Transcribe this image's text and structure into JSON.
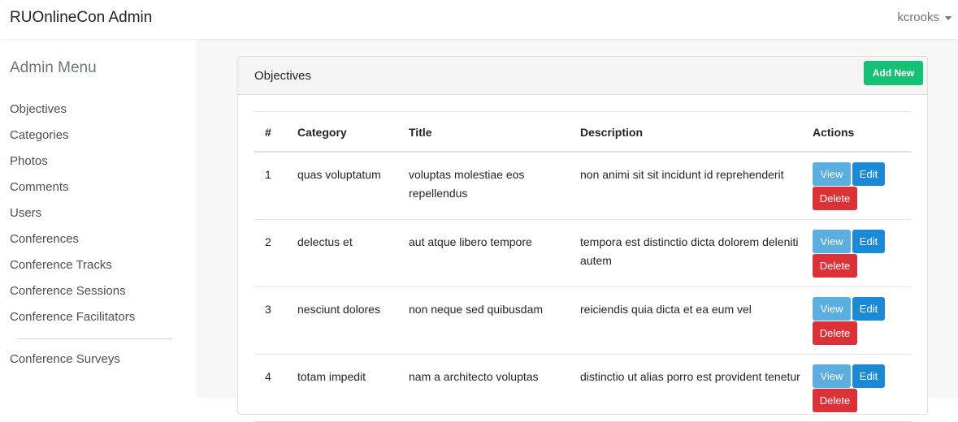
{
  "navbar": {
    "brand": "RUOnlineCon Admin",
    "user": "kcrooks"
  },
  "sidebar": {
    "title": "Admin Menu",
    "items": [
      {
        "label": "Objectives"
      },
      {
        "label": "Categories"
      },
      {
        "label": "Photos"
      },
      {
        "label": "Comments"
      },
      {
        "label": "Users"
      },
      {
        "label": "Conferences"
      },
      {
        "label": "Conference Tracks"
      },
      {
        "label": "Conference Sessions"
      },
      {
        "label": "Conference Facilitators"
      }
    ],
    "extra_item": "Conference Surveys"
  },
  "card": {
    "title": "Objectives",
    "add_label": "Add New"
  },
  "table": {
    "headers": [
      "#",
      "Category",
      "Title",
      "Description",
      "Actions"
    ],
    "rows": [
      {
        "num": "1",
        "category": "quas voluptatum",
        "title": "voluptas molestiae eos repellendus",
        "description": "non animi sit sit incidunt id reprehenderit"
      },
      {
        "num": "2",
        "category": "delectus et",
        "title": "aut atque libero tempore",
        "description": "tempora est distinctio dicta dolorem deleniti autem"
      },
      {
        "num": "3",
        "category": "nesciunt dolores",
        "title": "non neque sed quibusdam",
        "description": "reiciendis quia dicta et ea eum vel"
      },
      {
        "num": "4",
        "category": "totam impedit",
        "title": "nam a architecto voluptas",
        "description": "distinctio ut alias porro est provident tenetur"
      }
    ],
    "actions": {
      "view": "View",
      "edit": "Edit",
      "delete": "Delete"
    }
  },
  "colors": {
    "add": "#15c174",
    "view": "#5aaee0",
    "edit": "#1a8ad6",
    "delete": "#dc3136"
  }
}
